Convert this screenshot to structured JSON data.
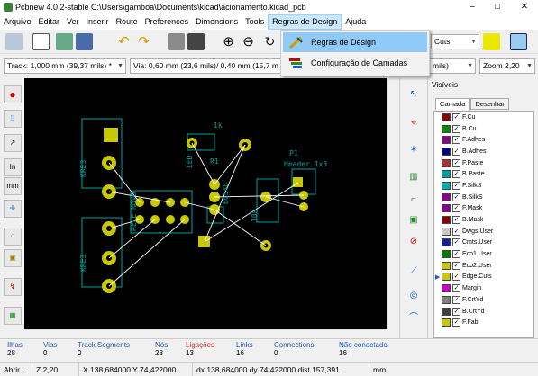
{
  "window": {
    "title": "Pcbnew 4.0.2-stable C:\\Users\\gamboa\\Documents\\kicad\\acionamento.kicad_pcb",
    "min": "–",
    "max": "□",
    "close": "✕"
  },
  "menubar": [
    "Arquivo",
    "Editar",
    "Ver",
    "Inserir",
    "Route",
    "Preferences",
    "Dimensions",
    "Tools",
    "Regras de Design",
    "Ajuda"
  ],
  "dropdown": {
    "items": [
      "Regras de Design",
      "Configuração de Camadas"
    ]
  },
  "toolbar2": {
    "track": "Track: 1,000 mm (39,37 mils) *",
    "via": "Via: 0,60 mm (23,6 mils)/ 0,40 mm (15,7 m",
    "grid": "mils)",
    "zoom": "Zoom 2,20",
    "layer_combo": "Cuts"
  },
  "layers_panel": {
    "title": "Visíveis",
    "tabs": [
      "Camada",
      "Desenhar"
    ],
    "items": [
      {
        "name": "F.Cu",
        "color": "#8b0000"
      },
      {
        "name": "B.Cu",
        "color": "#008b00"
      },
      {
        "name": "F.Adhes",
        "color": "#8b008b"
      },
      {
        "name": "B.Adhes",
        "color": "#00008b"
      },
      {
        "name": "F.Paste",
        "color": "#b03030"
      },
      {
        "name": "B.Paste",
        "color": "#00a0a0"
      },
      {
        "name": "F.SilkS",
        "color": "#00b0b0"
      },
      {
        "name": "B.SilkS",
        "color": "#8b008b"
      },
      {
        "name": "F.Mask",
        "color": "#8b008b"
      },
      {
        "name": "B.Mask",
        "color": "#8b0000"
      },
      {
        "name": "Dwgs.User",
        "color": "#c8c8c8"
      },
      {
        "name": "Cmts.User",
        "color": "#1a1aa0"
      },
      {
        "name": "Eco1.User",
        "color": "#008000"
      },
      {
        "name": "Eco2.User",
        "color": "#c8c800"
      },
      {
        "name": "Edge.Cuts",
        "color": "#c8c800"
      },
      {
        "name": "Margin",
        "color": "#c800c8"
      },
      {
        "name": "F.CrtYd",
        "color": "#808080"
      },
      {
        "name": "B.CrtYd",
        "color": "#404040"
      },
      {
        "name": "F.Fab",
        "color": "#c8c800"
      }
    ]
  },
  "messages": [
    {
      "label": "Ilhas",
      "value": "28",
      "color": "#2a5599"
    },
    {
      "label": "Vias",
      "value": "0",
      "color": "#2a5599"
    },
    {
      "label": "Track Segments",
      "value": "0",
      "color": "#2a5599"
    },
    {
      "label": "Nós",
      "value": "28",
      "color": "#2a5599"
    },
    {
      "label": "Ligações",
      "value": "13",
      "color": "#c03030"
    },
    {
      "label": "Links",
      "value": "16",
      "color": "#2a5599"
    },
    {
      "label": "Connections",
      "value": "0",
      "color": "#2a5599"
    },
    {
      "label": "Não conectado",
      "value": "16",
      "color": "#1560d4"
    }
  ],
  "status": {
    "file": "Abrir ...",
    "zoom": "Z 2,20",
    "xy": "X 138,684000  Y 74,422000",
    "dxy": "dx 138,684000  dy 74,422000  dist 157,391",
    "units": "mm"
  },
  "canvas": {
    "labels": [
      "1k",
      "LED",
      "R1",
      "BC548",
      "P1",
      "Header 1x3",
      "KRE3",
      "KRE3",
      "RELE NOVO",
      "10k",
      "Q1",
      "P1"
    ]
  }
}
